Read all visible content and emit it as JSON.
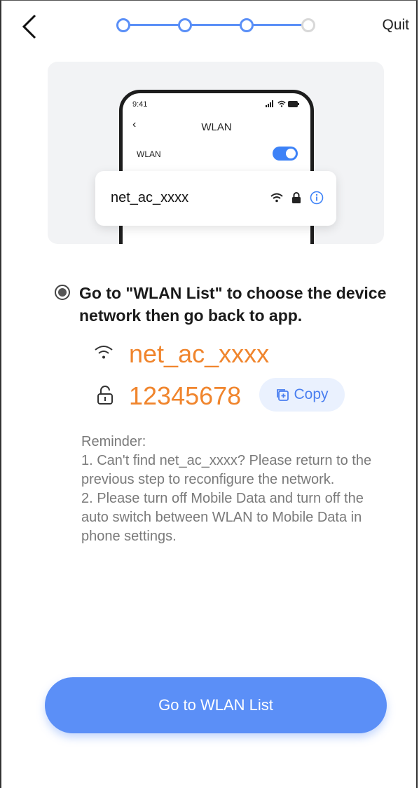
{
  "header": {
    "quit_label": "Quit",
    "progress": {
      "total_steps": 4,
      "completed_steps": 3
    }
  },
  "illustration": {
    "status_time": "9:41",
    "screen_title": "WLAN",
    "wlan_row_label": "WLAN",
    "wlan_toggle_on": true,
    "network_name": "net_ac_xxxx"
  },
  "instruction": {
    "text": "Go to \"WLAN List\" to choose the device network then go back to app."
  },
  "credentials": {
    "ssid": "net_ac_xxxx",
    "password": "12345678",
    "copy_label": "Copy"
  },
  "reminder": {
    "text": "Reminder:\n1. Can't find net_ac_xxxx? Please return to the previous step to reconfigure the network.\n2. Please turn off Mobile Data and turn off the auto switch between WLAN to Mobile Data in phone settings."
  },
  "cta": {
    "label": "Go to WLAN List"
  },
  "colors": {
    "accent": "#5b8ff7",
    "highlight": "#f0852d",
    "muted_text": "#7a7a7a"
  }
}
